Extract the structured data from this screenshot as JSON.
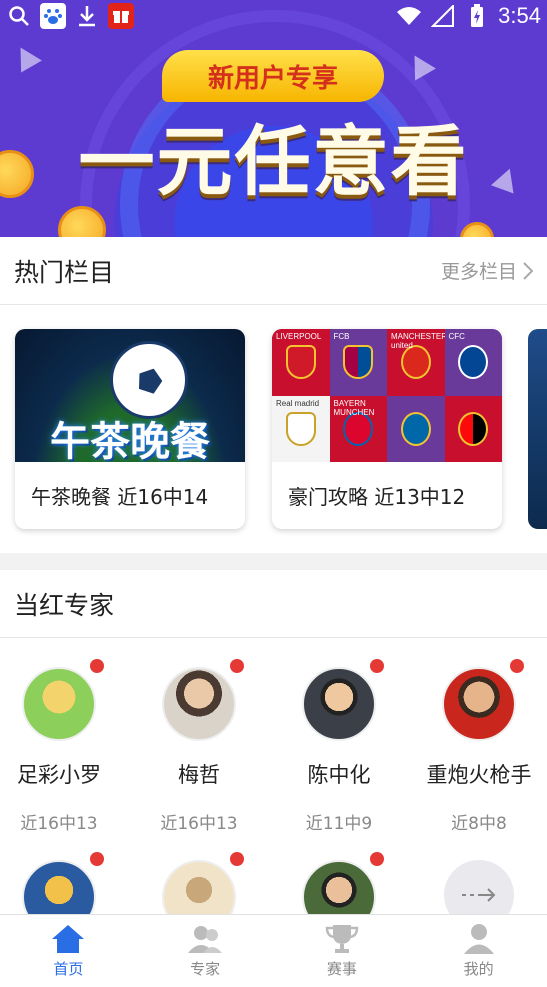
{
  "status_bar": {
    "time": "3:54"
  },
  "banner": {
    "tag": "新用户专享",
    "headline": "一元任意看"
  },
  "hot_columns": {
    "title": "热门栏目",
    "more_label": "更多栏目",
    "cards": [
      {
        "image_text": "午茶晚餐",
        "caption": "午茶晚餐 近16中14"
      },
      {
        "caption": "豪门攻略 近13中12"
      }
    ],
    "club_labels": [
      "LIVERPOOL",
      "FCB",
      "MANCHESTER united",
      "CFC",
      "Real madrid",
      "BAYERN MUNCHEN",
      "",
      ""
    ]
  },
  "experts": {
    "title": "当红专家",
    "list": [
      {
        "name": "足彩小罗",
        "record": "近16中13"
      },
      {
        "name": "梅哲",
        "record": "近16中13"
      },
      {
        "name": "陈中化",
        "record": "近11中9"
      },
      {
        "name": "重炮火枪手",
        "record": "近8中8"
      }
    ]
  },
  "bottom_nav": [
    {
      "label": "首页",
      "icon": "home-icon",
      "active": true
    },
    {
      "label": "专家",
      "icon": "experts-icon",
      "active": false
    },
    {
      "label": "赛事",
      "icon": "trophy-icon",
      "active": false
    },
    {
      "label": "我的",
      "icon": "profile-icon",
      "active": false
    }
  ],
  "colors": {
    "accent": "#2a6ee6",
    "badge": "#e53935",
    "banner": "#4a3dd8",
    "promo_tag": "#ffd43b"
  }
}
